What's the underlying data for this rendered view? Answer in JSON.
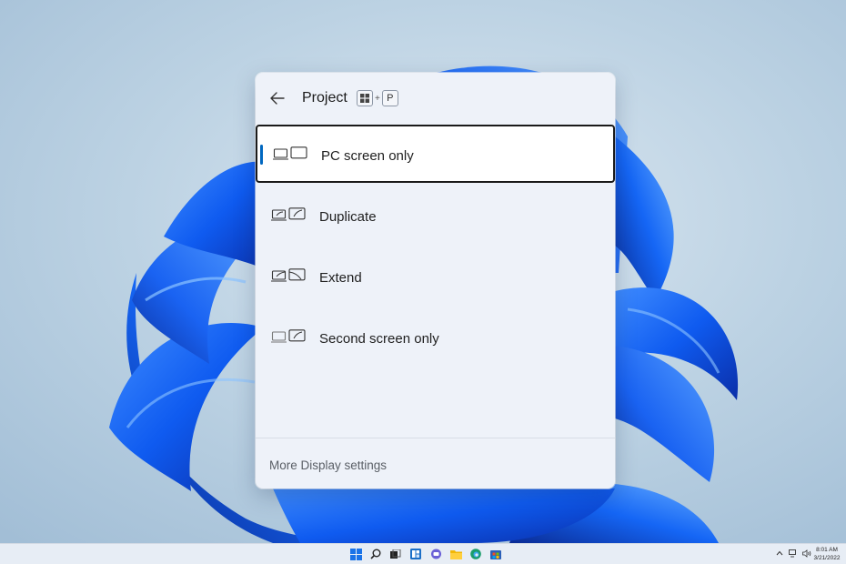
{
  "flyout": {
    "title": "Project",
    "shortcut_key_1": "",
    "shortcut_plus": "+",
    "shortcut_key_2": "P",
    "options": [
      {
        "label": "PC screen only",
        "selected": true,
        "icon": "pc-screen-only-icon"
      },
      {
        "label": "Duplicate",
        "selected": false,
        "icon": "duplicate-icon"
      },
      {
        "label": "Extend",
        "selected": false,
        "icon": "extend-icon"
      },
      {
        "label": "Second screen only",
        "selected": false,
        "icon": "second-screen-only-icon"
      }
    ],
    "footer_link": "More Display settings"
  },
  "taskbar": {
    "apps": [
      "start-icon",
      "search-icon",
      "task-view-icon",
      "widgets-icon",
      "chat-icon",
      "file-explorer-icon",
      "edge-icon",
      "store-icon"
    ],
    "clock_time": "8:01 AM",
    "clock_date": "3/21/2022"
  },
  "colors": {
    "accent": "#0067c0",
    "flyout_bg": "#eef2f9",
    "taskbar_bg": "#e7edf5"
  }
}
